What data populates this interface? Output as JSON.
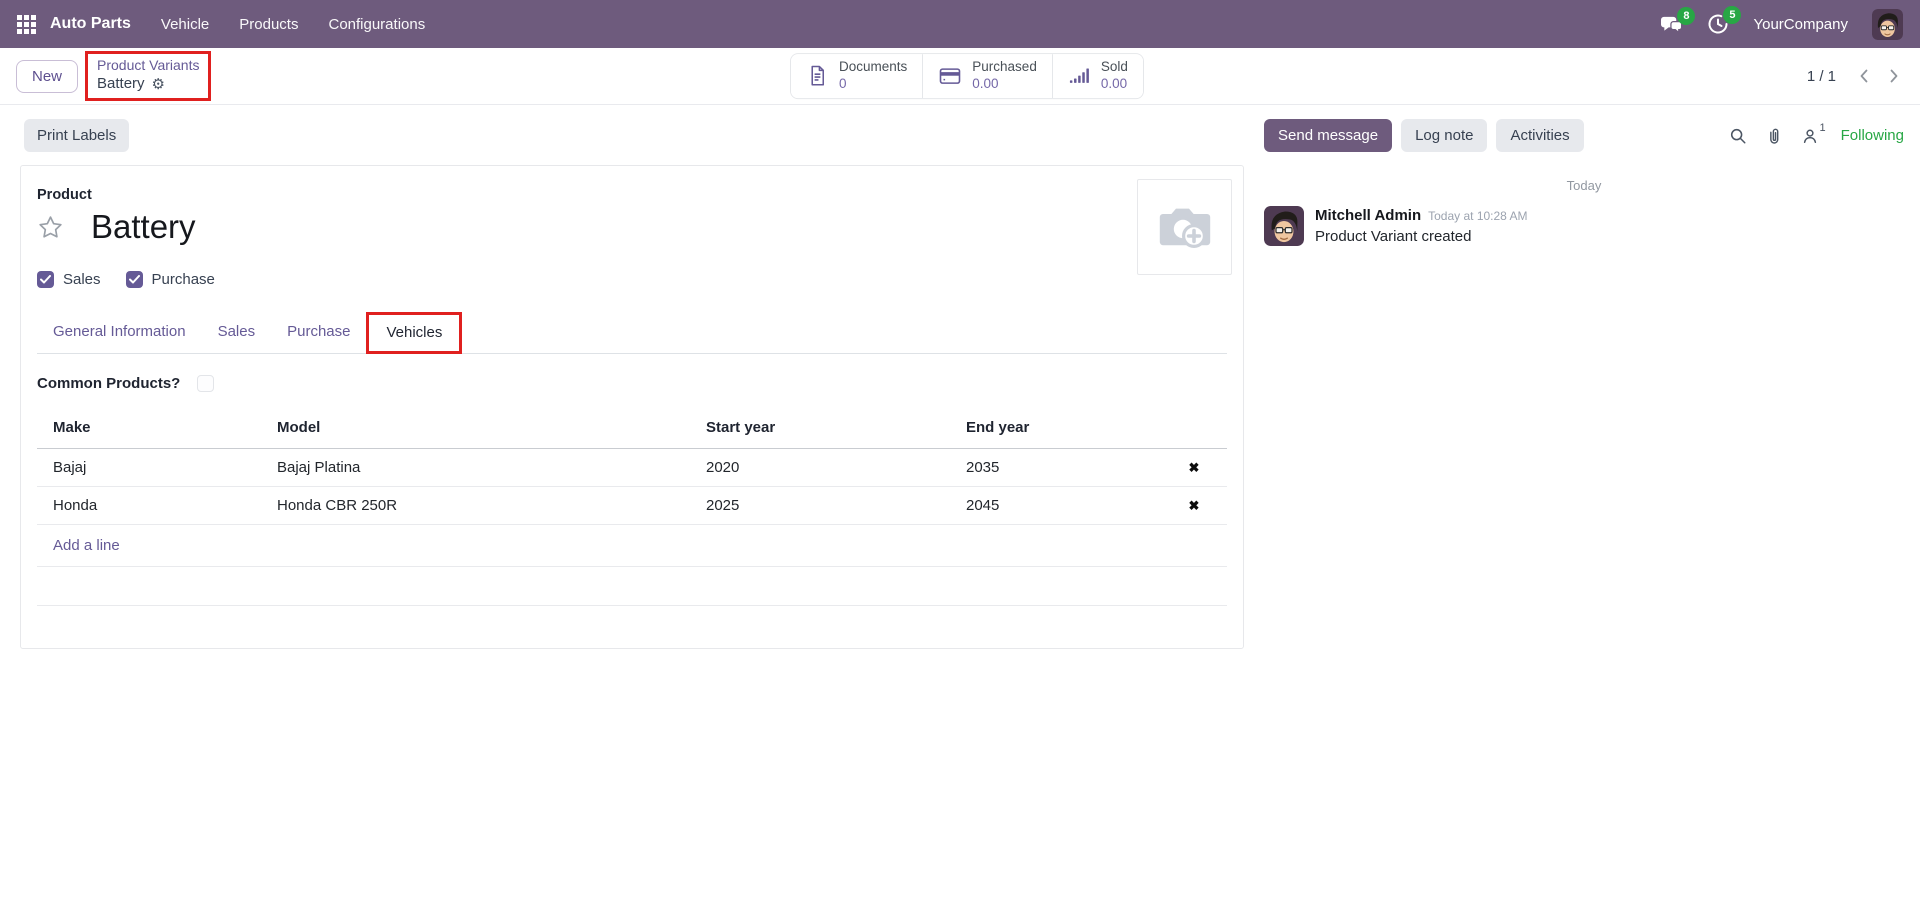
{
  "colors": {
    "navbar_bg": "#6e5b7d",
    "accent_purple": "#655a96",
    "stat_value_purple": "#7568a8",
    "badge_green": "#28a745",
    "following_green": "#28a745",
    "annotation_red": "#e0201f"
  },
  "navbar": {
    "app_name": "Auto Parts",
    "menus": [
      {
        "label": "Vehicle"
      },
      {
        "label": "Products"
      },
      {
        "label": "Configurations"
      }
    ],
    "messages_badge": "8",
    "activities_badge": "5",
    "company": "YourCompany"
  },
  "control_panel": {
    "new_label": "New",
    "breadcrumb": {
      "parent": "Product Variants",
      "current": "Battery"
    },
    "stats": [
      {
        "icon": "document-icon",
        "label": "Documents",
        "value": "0"
      },
      {
        "icon": "credit-card-icon",
        "label": "Purchased",
        "value": "0.00"
      },
      {
        "icon": "bar-chart-icon",
        "label": "Sold",
        "value": "0.00"
      }
    ],
    "pager": "1 / 1"
  },
  "form": {
    "print_labels_label": "Print Labels",
    "product_label": "Product",
    "product_name": "Battery",
    "options": [
      {
        "label": "Sales",
        "checked": true
      },
      {
        "label": "Purchase",
        "checked": true
      }
    ],
    "tabs": [
      {
        "label": "General Information",
        "active": false
      },
      {
        "label": "Sales",
        "active": false
      },
      {
        "label": "Purchase",
        "active": false
      },
      {
        "label": "Vehicles",
        "active": true
      }
    ],
    "common_products_label": "Common Products?",
    "common_products_checked": false,
    "table": {
      "headers": [
        "Make",
        "Model",
        "Start year",
        "End year"
      ],
      "rows": [
        {
          "make": "Bajaj",
          "model": "Bajaj Platina",
          "start_year": "2020",
          "end_year": "2035"
        },
        {
          "make": "Honda",
          "model": "Honda CBR 250R",
          "start_year": "2025",
          "end_year": "2045"
        }
      ],
      "add_line_label": "Add a line"
    }
  },
  "chatter": {
    "buttons": [
      {
        "label": "Send message"
      },
      {
        "label": "Log note"
      },
      {
        "label": "Activities"
      }
    ],
    "followers_count": "1",
    "following_label": "Following",
    "date_divider": "Today",
    "message": {
      "author": "Mitchell Admin",
      "timestamp": "Today at 10:28 AM",
      "body": "Product Variant created"
    }
  },
  "icons": {
    "gear": "⚙",
    "delete": "✖"
  }
}
